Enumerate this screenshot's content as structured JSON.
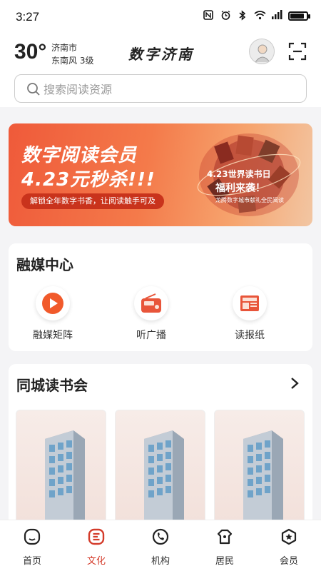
{
  "status_bar": {
    "time": "3:27",
    "battery_level": 0.85
  },
  "header": {
    "temperature": "30°",
    "city": "济南市",
    "wind": "东南风  3级",
    "app_title": "数字济南"
  },
  "search": {
    "placeholder": "搜索阅读资源"
  },
  "banner": {
    "line1": "数字阅读会员",
    "line2": "4.23元秒杀!!!",
    "tagline": "解锁全年数字书香，让阅读触手可及",
    "badge_line1": "4.23世界读书日",
    "badge_line2": "福利来袭！",
    "badge_line3": "龙腾数字城市献礼全民阅读"
  },
  "media_center": {
    "title": "融媒中心",
    "items": [
      {
        "label": "融媒矩阵",
        "icon": "play-icon"
      },
      {
        "label": "听广播",
        "icon": "radio-icon"
      },
      {
        "label": "读报纸",
        "icon": "newspaper-icon"
      }
    ]
  },
  "book_club": {
    "title": "同城读书会",
    "more_icon": "chevron-right-icon"
  },
  "tabs": [
    {
      "label": "首页",
      "icon": "home-icon"
    },
    {
      "label": "文化",
      "icon": "culture-icon"
    },
    {
      "label": "机构",
      "icon": "phone-icon"
    },
    {
      "label": "居民",
      "icon": "resident-icon"
    },
    {
      "label": "会员",
      "icon": "member-star-icon"
    }
  ],
  "colors": {
    "accent": "#d43b2a",
    "banner_start": "#ef5a3a",
    "banner_end": "#f2c6a3"
  }
}
